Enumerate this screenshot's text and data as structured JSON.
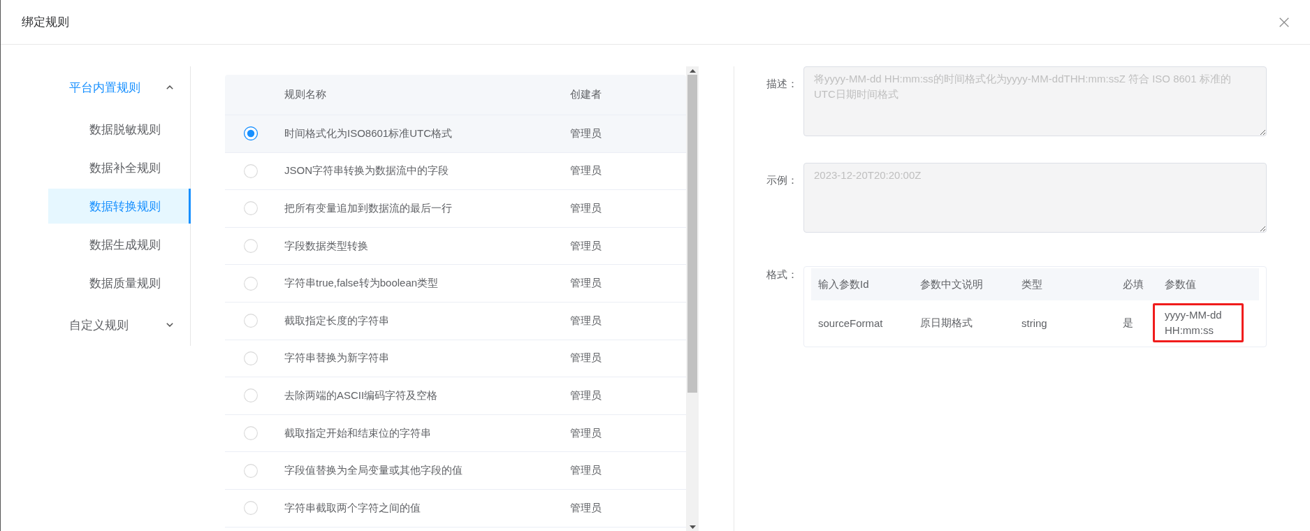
{
  "dialog": {
    "title": "绑定规则"
  },
  "sidebar": {
    "groups": [
      {
        "label": "平台内置规则",
        "expanded": true,
        "children": [
          {
            "label": "数据脱敏规则",
            "selected": false
          },
          {
            "label": "数据补全规则",
            "selected": false
          },
          {
            "label": "数据转换规则",
            "selected": true
          },
          {
            "label": "数据生成规则",
            "selected": false
          },
          {
            "label": "数据质量规则",
            "selected": false
          }
        ]
      },
      {
        "label": "自定义规则",
        "expanded": false
      }
    ]
  },
  "rule_table": {
    "columns": [
      "规则名称",
      "创建者"
    ],
    "rows": [
      {
        "name": "时间格式化为ISO8601标准UTC格式",
        "creator": "管理员",
        "selected": true
      },
      {
        "name": "JSON字符串转换为数据流中的字段",
        "creator": "管理员",
        "selected": false
      },
      {
        "name": "把所有变量追加到数据流的最后一行",
        "creator": "管理员",
        "selected": false
      },
      {
        "name": "字段数据类型转换",
        "creator": "管理员",
        "selected": false
      },
      {
        "name": "字符串true,false转为boolean类型",
        "creator": "管理员",
        "selected": false
      },
      {
        "name": "截取指定长度的字符串",
        "creator": "管理员",
        "selected": false
      },
      {
        "name": "字符串替换为新字符串",
        "creator": "管理员",
        "selected": false
      },
      {
        "name": "去除两端的ASCII编码字符及空格",
        "creator": "管理员",
        "selected": false
      },
      {
        "name": "截取指定开始和结束位的字符串",
        "creator": "管理员",
        "selected": false
      },
      {
        "name": "字段值替换为全局变量或其他字段的值",
        "creator": "管理员",
        "selected": false
      },
      {
        "name": "字符串截取两个字符之间的值",
        "creator": "管理员",
        "selected": false
      }
    ]
  },
  "detail": {
    "description": {
      "label": "描述：",
      "value": "将yyyy-MM-dd HH:mm:ss的时间格式化为yyyy-MM-ddTHH:mm:ssZ 符合 ISO 8601 标准的UTC日期时间格式",
      "disabled": true
    },
    "example": {
      "label": "示例：",
      "value": "2023-12-20T20:20:00Z",
      "disabled": true
    },
    "format": {
      "label": "格式：",
      "columns": [
        "输入参数Id",
        "参数中文说明",
        "类型",
        "必填",
        "参数值"
      ],
      "rows": [
        {
          "id": "sourceFormat",
          "description": "原日期格式",
          "type": "string",
          "required": "是",
          "value": "yyyy-MM-dd HH:mm:ss",
          "highlighted": true
        }
      ]
    }
  }
}
